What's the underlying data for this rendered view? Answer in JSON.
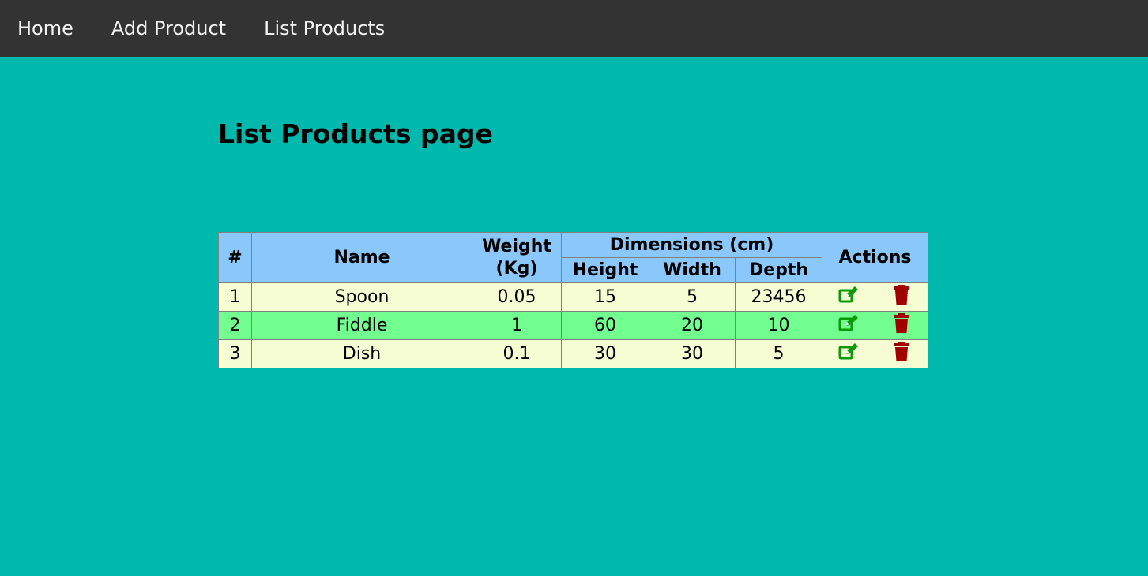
{
  "nav": {
    "home": "Home",
    "add_product": "Add Product",
    "list_products": "List Products"
  },
  "page": {
    "title": "List Products page"
  },
  "table": {
    "headers": {
      "num": "#",
      "name": "Name",
      "weight_line1": "Weight",
      "weight_line2": "(Kg)",
      "dimensions": "Dimensions (cm)",
      "height": "Height",
      "width": "Width",
      "depth": "Depth",
      "actions": "Actions"
    },
    "rows": [
      {
        "num": "1",
        "name": "Spoon",
        "weight": "0.05",
        "height": "15",
        "width": "5",
        "depth": "23456"
      },
      {
        "num": "2",
        "name": "Fiddle",
        "weight": "1",
        "height": "60",
        "width": "20",
        "depth": "10"
      },
      {
        "num": "3",
        "name": "Dish",
        "weight": "0.1",
        "height": "30",
        "width": "30",
        "depth": "5"
      }
    ],
    "icons": {
      "edit": "edit-icon",
      "delete": "trash-icon"
    }
  },
  "colors": {
    "background": "#00b8ab",
    "navbar": "#333333",
    "header": "#8ac8fb",
    "row_odd": "#f6fdd3",
    "row_even": "#72ff90",
    "edit_icon": "#0a9a0a",
    "delete_icon": "#a00000"
  }
}
